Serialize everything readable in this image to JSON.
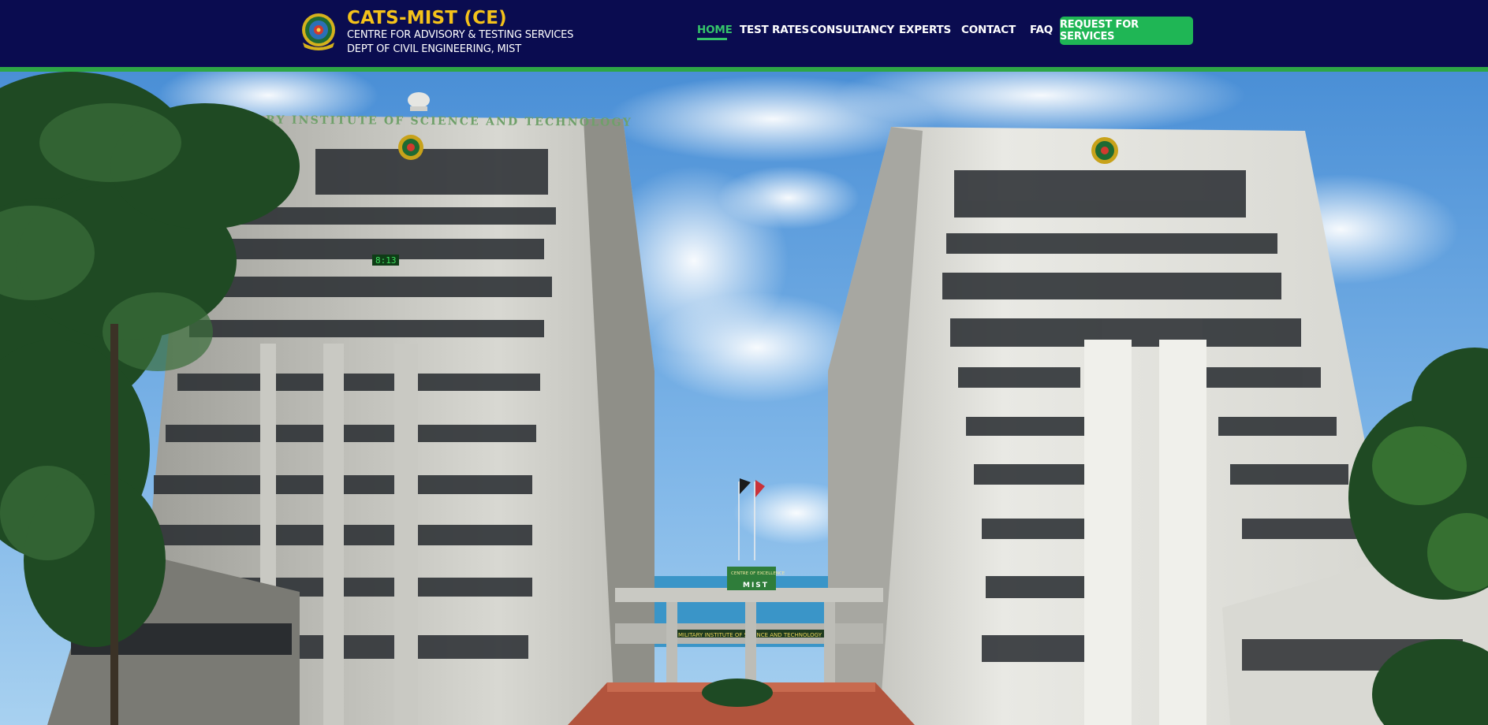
{
  "brand": {
    "title": "CATS-MIST (CE)",
    "subtitle_line1": "CENTRE FOR ADVISORY & TESTING SERVICES",
    "subtitle_line2": "DEPT OF CIVIL ENGINEERING, MIST"
  },
  "nav": {
    "items": [
      {
        "label": "HOME",
        "active": true
      },
      {
        "label": "TEST RATES"
      },
      {
        "label": "CONSULTANCY"
      },
      {
        "label": "EXPERTS"
      },
      {
        "label": "CONTACT"
      },
      {
        "label": "FAQ"
      }
    ],
    "cta_label": "REQUEST FOR SERVICES"
  },
  "hero": {
    "roof_sign": "MILITARY INSTITUTE OF SCIENCE AND TECHNOLOGY",
    "bridge_sign": "MILITARY INSTITUTE OF SCIENCE AND TECHNOLOGY",
    "center_sign_line1": "CENTRE OF EXCELLENCE",
    "center_sign_line2": "MIST",
    "clock_display": "8:13"
  },
  "colors": {
    "header_bg": "#0a0c50",
    "accent_green": "#2ea646",
    "brand_yellow": "#f4c21a",
    "active_nav": "#35c46a",
    "cta_bg": "#1fb655"
  },
  "icons": {
    "logo": "mist-emblem-logo"
  }
}
